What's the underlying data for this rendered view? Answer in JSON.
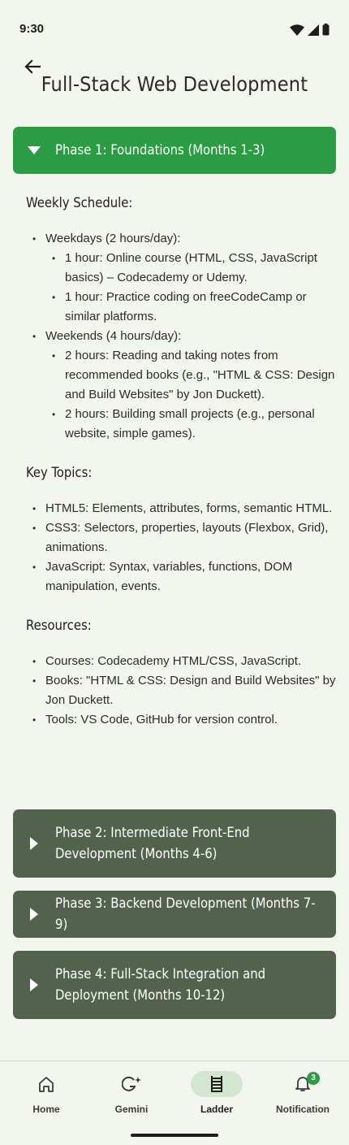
{
  "status": {
    "time": "9:30"
  },
  "title": "Full-Stack Web Development",
  "phases": [
    {
      "label": "Phase 1: Foundations (Months 1-3)",
      "expanded": true
    },
    {
      "label": "Phase 2: Intermediate Front-End Development (Months 4-6)",
      "expanded": false
    },
    {
      "label": "Phase 3: Backend Development (Months 7-9)",
      "expanded": false
    },
    {
      "label": "Phase 4: Full-Stack Integration and Deployment (Months 10-12)",
      "expanded": false
    }
  ],
  "phase1": {
    "weekly_title": "Weekly Schedule:",
    "weekdays": {
      "label": "Weekdays (2 hours/day):",
      "items": [
        "1 hour: Online course (HTML, CSS, JavaScript basics) – Codecademy or Udemy.",
        "1 hour: Practice coding on freeCodeCamp or similar platforms."
      ]
    },
    "weekends": {
      "label": "Weekends (4 hours/day):",
      "items": [
        "2 hours: Reading and taking notes from recommended books (e.g., \"HTML & CSS: Design and Build Websites\" by Jon Duckett).",
        "2 hours: Building small projects (e.g., personal website, simple games)."
      ]
    },
    "topics_title": "Key Topics:",
    "topics": [
      "HTML5: Elements, attributes, forms, semantic HTML.",
      "CSS3: Selectors, properties, layouts (Flexbox, Grid), animations.",
      "JavaScript: Syntax, variables, functions, DOM manipulation, events."
    ],
    "resources_title": "Resources:",
    "resources": [
      "Courses: Codecademy HTML/CSS, JavaScript.",
      "Books: \"HTML & CSS: Design and Build Websites\" by Jon Duckett.",
      "Tools: VS Code, GitHub for version control."
    ]
  },
  "nav": [
    {
      "label": "Home",
      "icon": "home-icon"
    },
    {
      "label": "Gemini",
      "icon": "gemini-icon"
    },
    {
      "label": "Ladder",
      "icon": "ladder-icon",
      "active": true
    },
    {
      "label": "Notification",
      "icon": "bell-icon",
      "badge": "3"
    }
  ],
  "colors": {
    "accent": "#2b9c43",
    "collapsed": "#53624d",
    "background": "#f3f6ee",
    "nav_active_pill": "#d3e6cf"
  }
}
